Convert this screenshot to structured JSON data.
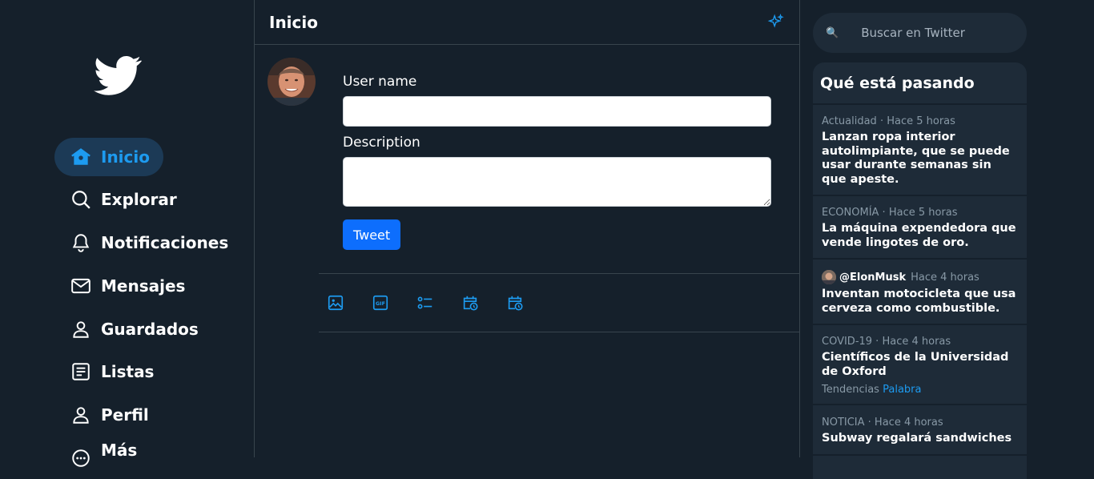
{
  "sidebar": {
    "items": [
      {
        "label": "Inicio",
        "icon": "home-icon",
        "active": true
      },
      {
        "label": "Explorar",
        "icon": "search-icon"
      },
      {
        "label": "Notificaciones",
        "icon": "bell-icon"
      },
      {
        "label": "Mensajes",
        "icon": "mail-icon"
      },
      {
        "label": "Guardados",
        "icon": "person-icon"
      },
      {
        "label": "Listas",
        "icon": "list-icon"
      },
      {
        "label": "Perfil",
        "icon": "person-icon"
      },
      {
        "label": "Más",
        "icon": "more-icon"
      }
    ]
  },
  "main": {
    "title": "Inicio",
    "form": {
      "username_label": "User name",
      "username_value": "",
      "description_label": "Description",
      "description_value": "",
      "submit_label": "Tweet"
    },
    "toolbar": [
      "image-icon",
      "gif-icon",
      "poll-icon",
      "schedule-icon",
      "schedule-icon"
    ]
  },
  "search": {
    "placeholder": "Buscar en Twitter"
  },
  "trends": {
    "title": "Qué está pasando",
    "items": [
      {
        "meta": "Actualidad · Hace 5 horas",
        "title": "Lanzan ropa interior autolimpiante, que se puede usar durante semanas sin que apeste."
      },
      {
        "meta": "ECONOMÍA · Hace 5 horas",
        "title": "La máquina expendedora que vende lingotes de oro."
      },
      {
        "handle": "@ElonMusk",
        "meta": "Hace 4 horas",
        "title": "Inventan motocicleta que usa cerveza como combustible."
      },
      {
        "meta": "COVID-19 · Hace 4 horas",
        "title": "Científicos de la Universidad de Oxford",
        "tag_prefix": "Tendencias",
        "tag_link": "Palabra"
      },
      {
        "meta": "NOTICIA · Hace 4 horas",
        "title": "Subway regalará sandwiches"
      }
    ]
  },
  "colors": {
    "accent": "#1d9bf0",
    "background": "#15202b",
    "card": "#1e2b38",
    "button": "#0d6efd"
  }
}
